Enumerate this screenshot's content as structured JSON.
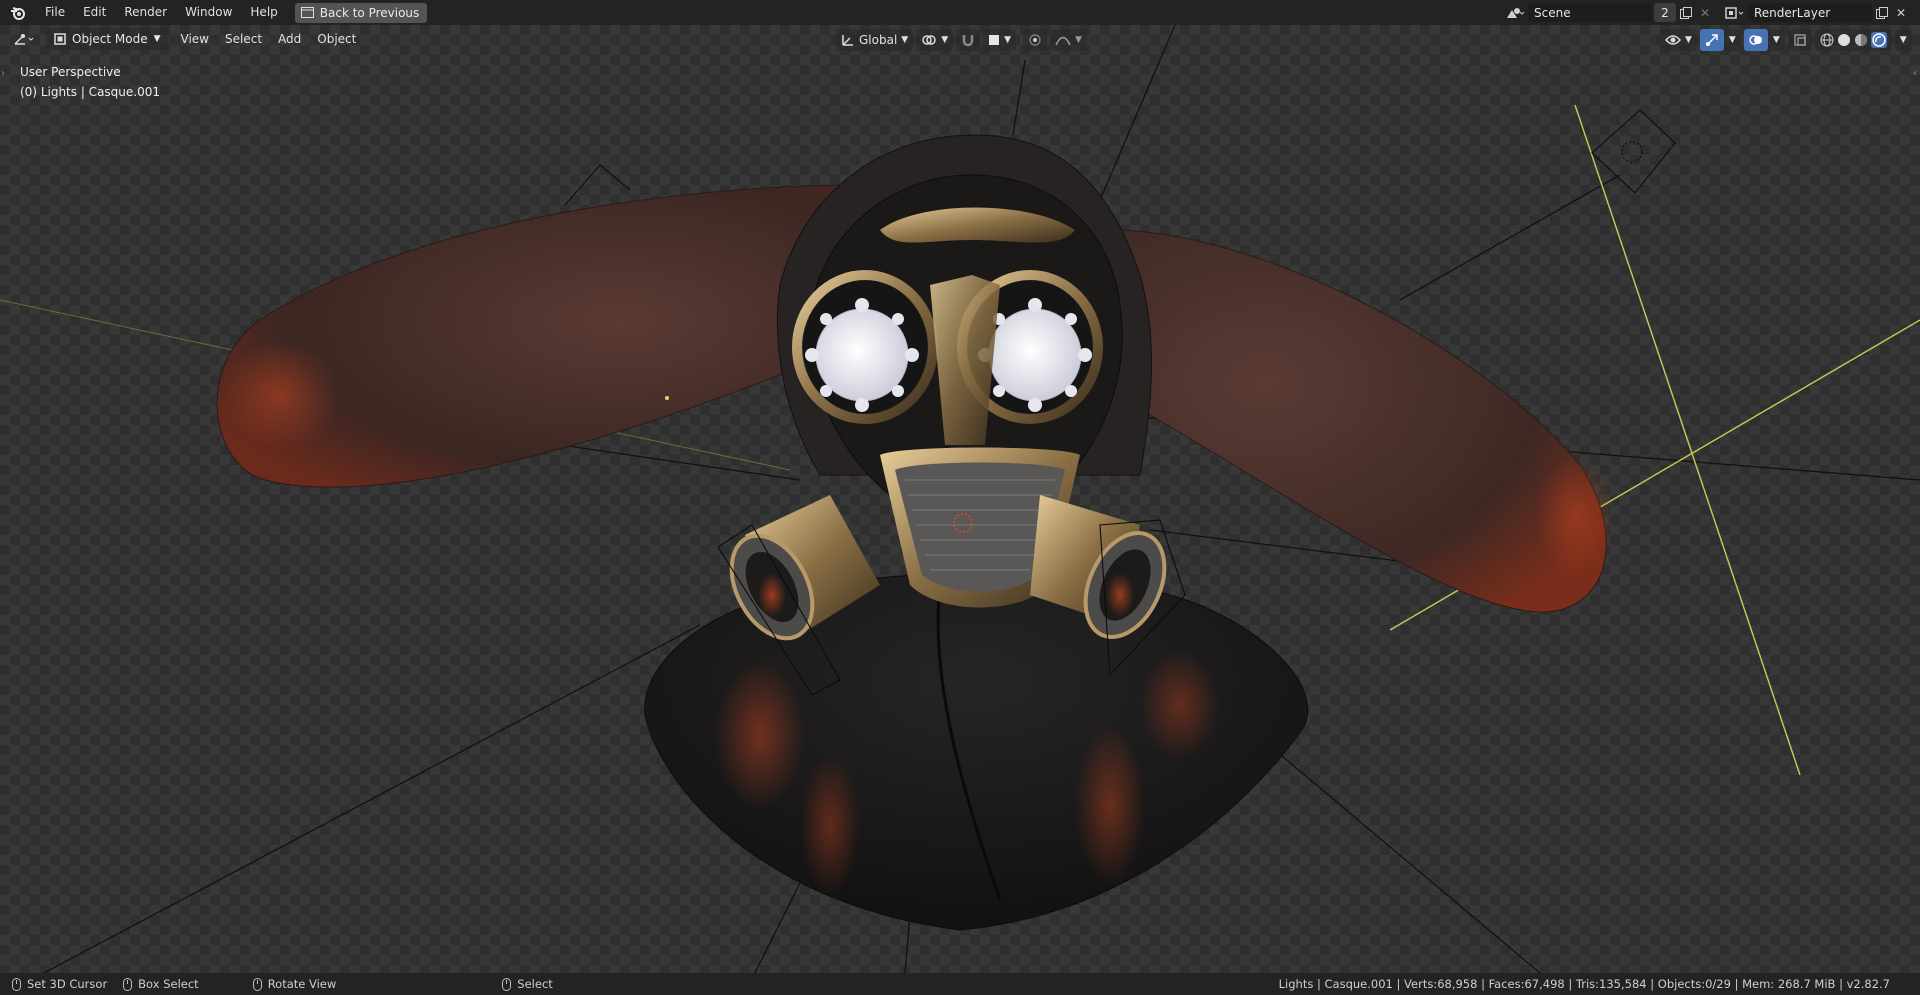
{
  "topbar": {
    "menus": [
      "File",
      "Edit",
      "Render",
      "Window",
      "Help"
    ],
    "back_label": "Back to Previous",
    "scene_name": "Scene",
    "scene_users": "2",
    "render_layer": "RenderLayer"
  },
  "header": {
    "mode": "Object Mode",
    "menus": [
      "View",
      "Select",
      "Add",
      "Object"
    ],
    "transform_orientation": "Global"
  },
  "viewport": {
    "perspective": "User Perspective",
    "active_info": "(0) Lights | Casque.001"
  },
  "statusbar": {
    "items": [
      {
        "label": "Set 3D Cursor",
        "icon": "mouse-left-icon"
      },
      {
        "label": "Box Select",
        "icon": "mouse-drag-icon"
      },
      {
        "label": "Rotate View",
        "icon": "mouse-middle-icon"
      },
      {
        "label": "Select",
        "icon": "mouse-right-icon"
      }
    ],
    "stats": "Lights | Casque.001 | Verts:68,958 | Faces:67,498 | Tris:135,584 | Objects:0/29 | Mem: 268.7 MiB | v2.82.7"
  },
  "colors": {
    "accent": "#4772b3",
    "topbar_bg": "#232323",
    "field_bg": "#1d1d1d",
    "light_gizmo": "#c8cc55"
  }
}
